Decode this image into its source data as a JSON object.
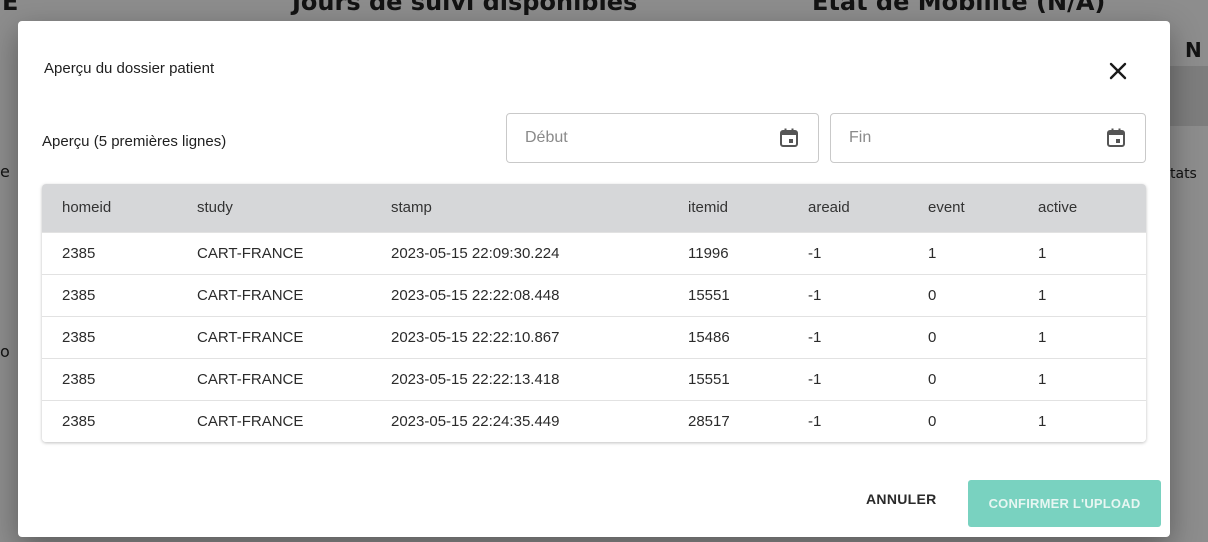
{
  "background": {
    "heading_1": "Jours de suivi disponibles",
    "heading_2": "État de Mobilité (N/A)",
    "heading_3": "E",
    "fragment_n": "N",
    "fragment_tats": "tats",
    "fragment_e": "e",
    "fragment_o": "o"
  },
  "dialog": {
    "title": "Aperçu du dossier patient",
    "close_icon": "close-icon",
    "subtitle": "Aperçu (5 premières lignes)",
    "date_start": {
      "placeholder": "Début",
      "value": "",
      "icon": "calendar-icon"
    },
    "date_end": {
      "placeholder": "Fin",
      "value": "",
      "icon": "calendar-icon"
    },
    "table": {
      "headers": [
        "homeid",
        "study",
        "stamp",
        "itemid",
        "areaid",
        "event",
        "active"
      ],
      "rows": [
        [
          "2385",
          "CART-FRANCE",
          "2023-05-15 22:09:30.224",
          "11996",
          "-1",
          "1",
          "1"
        ],
        [
          "2385",
          "CART-FRANCE",
          "2023-05-15 22:22:08.448",
          "15551",
          "-1",
          "0",
          "1"
        ],
        [
          "2385",
          "CART-FRANCE",
          "2023-05-15 22:22:10.867",
          "15486",
          "-1",
          "0",
          "1"
        ],
        [
          "2385",
          "CART-FRANCE",
          "2023-05-15 22:22:13.418",
          "15551",
          "-1",
          "0",
          "1"
        ],
        [
          "2385",
          "CART-FRANCE",
          "2023-05-15 22:24:35.449",
          "28517",
          "-1",
          "0",
          "1"
        ]
      ]
    },
    "cancel_label": "ANNULER",
    "confirm_label": "CONFIRMER L'UPLOAD",
    "colors": {
      "confirm_bg": "#79d2c0",
      "header_bg": "#d6d7d9"
    }
  }
}
